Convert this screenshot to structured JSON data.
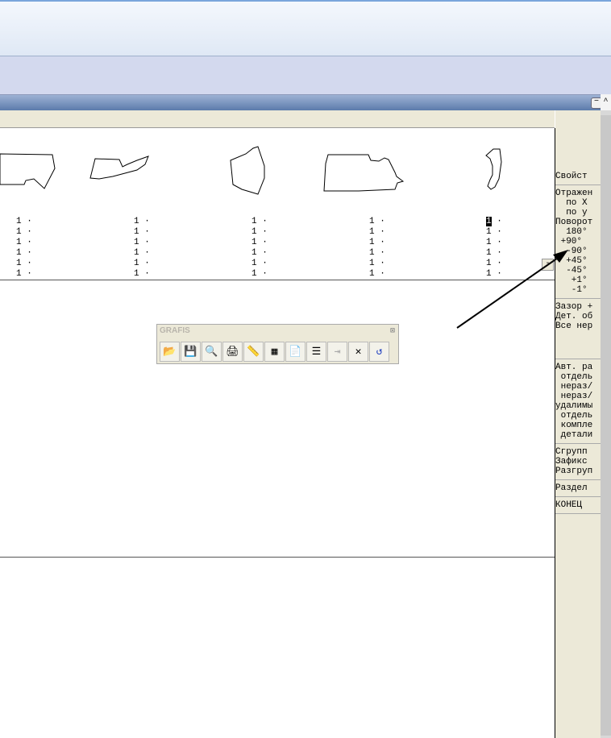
{
  "toolbar": {
    "title": "GRAFIS",
    "buttons": [
      "open-icon",
      "save-icon",
      "zoom-icon",
      "print-icon",
      "ruler-icon",
      "pieces-icon",
      "page-icon",
      "list-icon",
      "merge-icon",
      "delete-icon",
      "undo-icon"
    ]
  },
  "counts": {
    "value": "1 ·",
    "selected": "1"
  },
  "panel": {
    "g1": [
      "Свойст"
    ],
    "g2": [
      "Отражен",
      "  по X",
      "  по y",
      "Поворот",
      "  180°",
      " +90°",
      "  -90°",
      "  +45°",
      "  -45°",
      "   +1°",
      "   -1°"
    ],
    "g3": [
      "Зазор +",
      "Дет. об",
      "Все нер"
    ],
    "g4": [
      "Авт. ра",
      " отдель",
      " нераз/",
      " нераз/",
      "удалимы",
      " отдель",
      " компле",
      " детали"
    ],
    "g5": [
      "Сгрупп",
      "Зафикс",
      "Разгруп"
    ],
    "g6": [
      "Раздел"
    ],
    "g7": [
      "КОНЕЦ"
    ]
  },
  "minus": "-"
}
